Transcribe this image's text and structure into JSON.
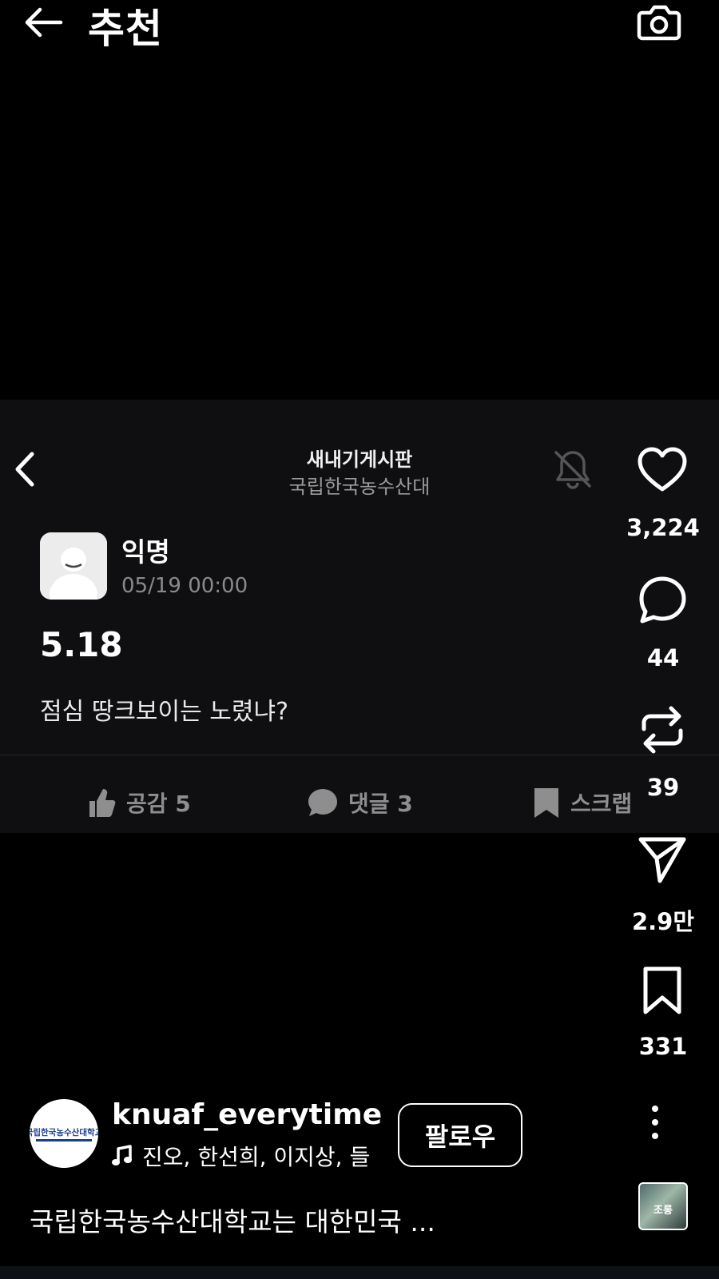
{
  "header": {
    "title": "추천",
    "back_icon": "back-arrow-icon",
    "camera_icon": "camera-icon"
  },
  "post_card": {
    "board_title": "새내기게시판",
    "board_subtitle": "국립한국농수산대",
    "author": "익명",
    "date": "05/19 00:00",
    "title": "5.18",
    "body": "점심 땅크보이는 노렸냐?",
    "actions": {
      "like_label": "공감 5",
      "comment_label": "댓글 3",
      "scrap_label": "스크랩"
    }
  },
  "rail": {
    "likes": "3,224",
    "comments": "44",
    "reposts": "39",
    "shares": "2.9만",
    "saves": "331"
  },
  "account": {
    "username": "knuaf_everytime",
    "avatar_text": "국립한국농수산대학교",
    "music": "진오, 한선희, 이지상, 들",
    "follow_label": "팔로우"
  },
  "caption": "국립한국농수산대학교는 대한민국 ...",
  "audio_thumb_text": "조롱",
  "colors": {
    "background": "#000000",
    "card_background": "#0f0e11",
    "muted_text": "#8e8e8e"
  }
}
